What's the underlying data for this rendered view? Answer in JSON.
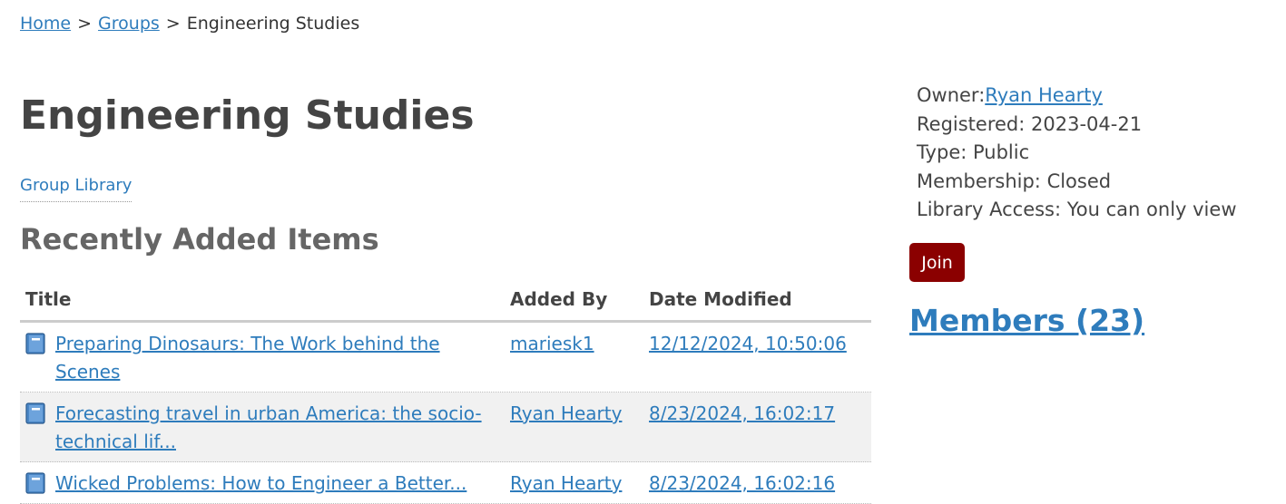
{
  "breadcrumb": {
    "home": "Home",
    "groups": "Groups",
    "sep": ">",
    "current": "Engineering Studies"
  },
  "group": {
    "title": "Engineering Studies"
  },
  "tabs": {
    "library": "Group Library"
  },
  "recent": {
    "heading": "Recently Added Items",
    "columns": {
      "title": "Title",
      "added_by": "Added By",
      "date_modified": "Date Modified"
    },
    "rows": [
      {
        "icon": "book-icon",
        "title": "Preparing Dinosaurs: The Work behind the Scenes",
        "added_by": "mariesk1",
        "date": "12/12/2024, 10:50:06"
      },
      {
        "icon": "book-icon",
        "title": "Forecasting travel in urban America: the socio-technical lif...",
        "added_by": "Ryan Hearty",
        "date": "8/23/2024, 16:02:17"
      },
      {
        "icon": "book-icon",
        "title": "Wicked Problems: How to Engineer a Better...",
        "added_by": "Ryan Hearty",
        "date": "8/23/2024, 16:02:16"
      }
    ]
  },
  "sidebar": {
    "owner_label": "Owner:",
    "owner": "Ryan Hearty",
    "registered_label": "Registered:",
    "registered": "2023-04-21",
    "type_label": "Type:",
    "type": "Public",
    "membership_label": "Membership:",
    "membership": "Closed",
    "access_label": "Library Access:",
    "access": "You can only view",
    "join": "Join",
    "members": "Members (23)"
  },
  "colors": {
    "link": "#2e7cbc",
    "join_button": "#8b0000",
    "row_alt": "#f1f1f1"
  }
}
